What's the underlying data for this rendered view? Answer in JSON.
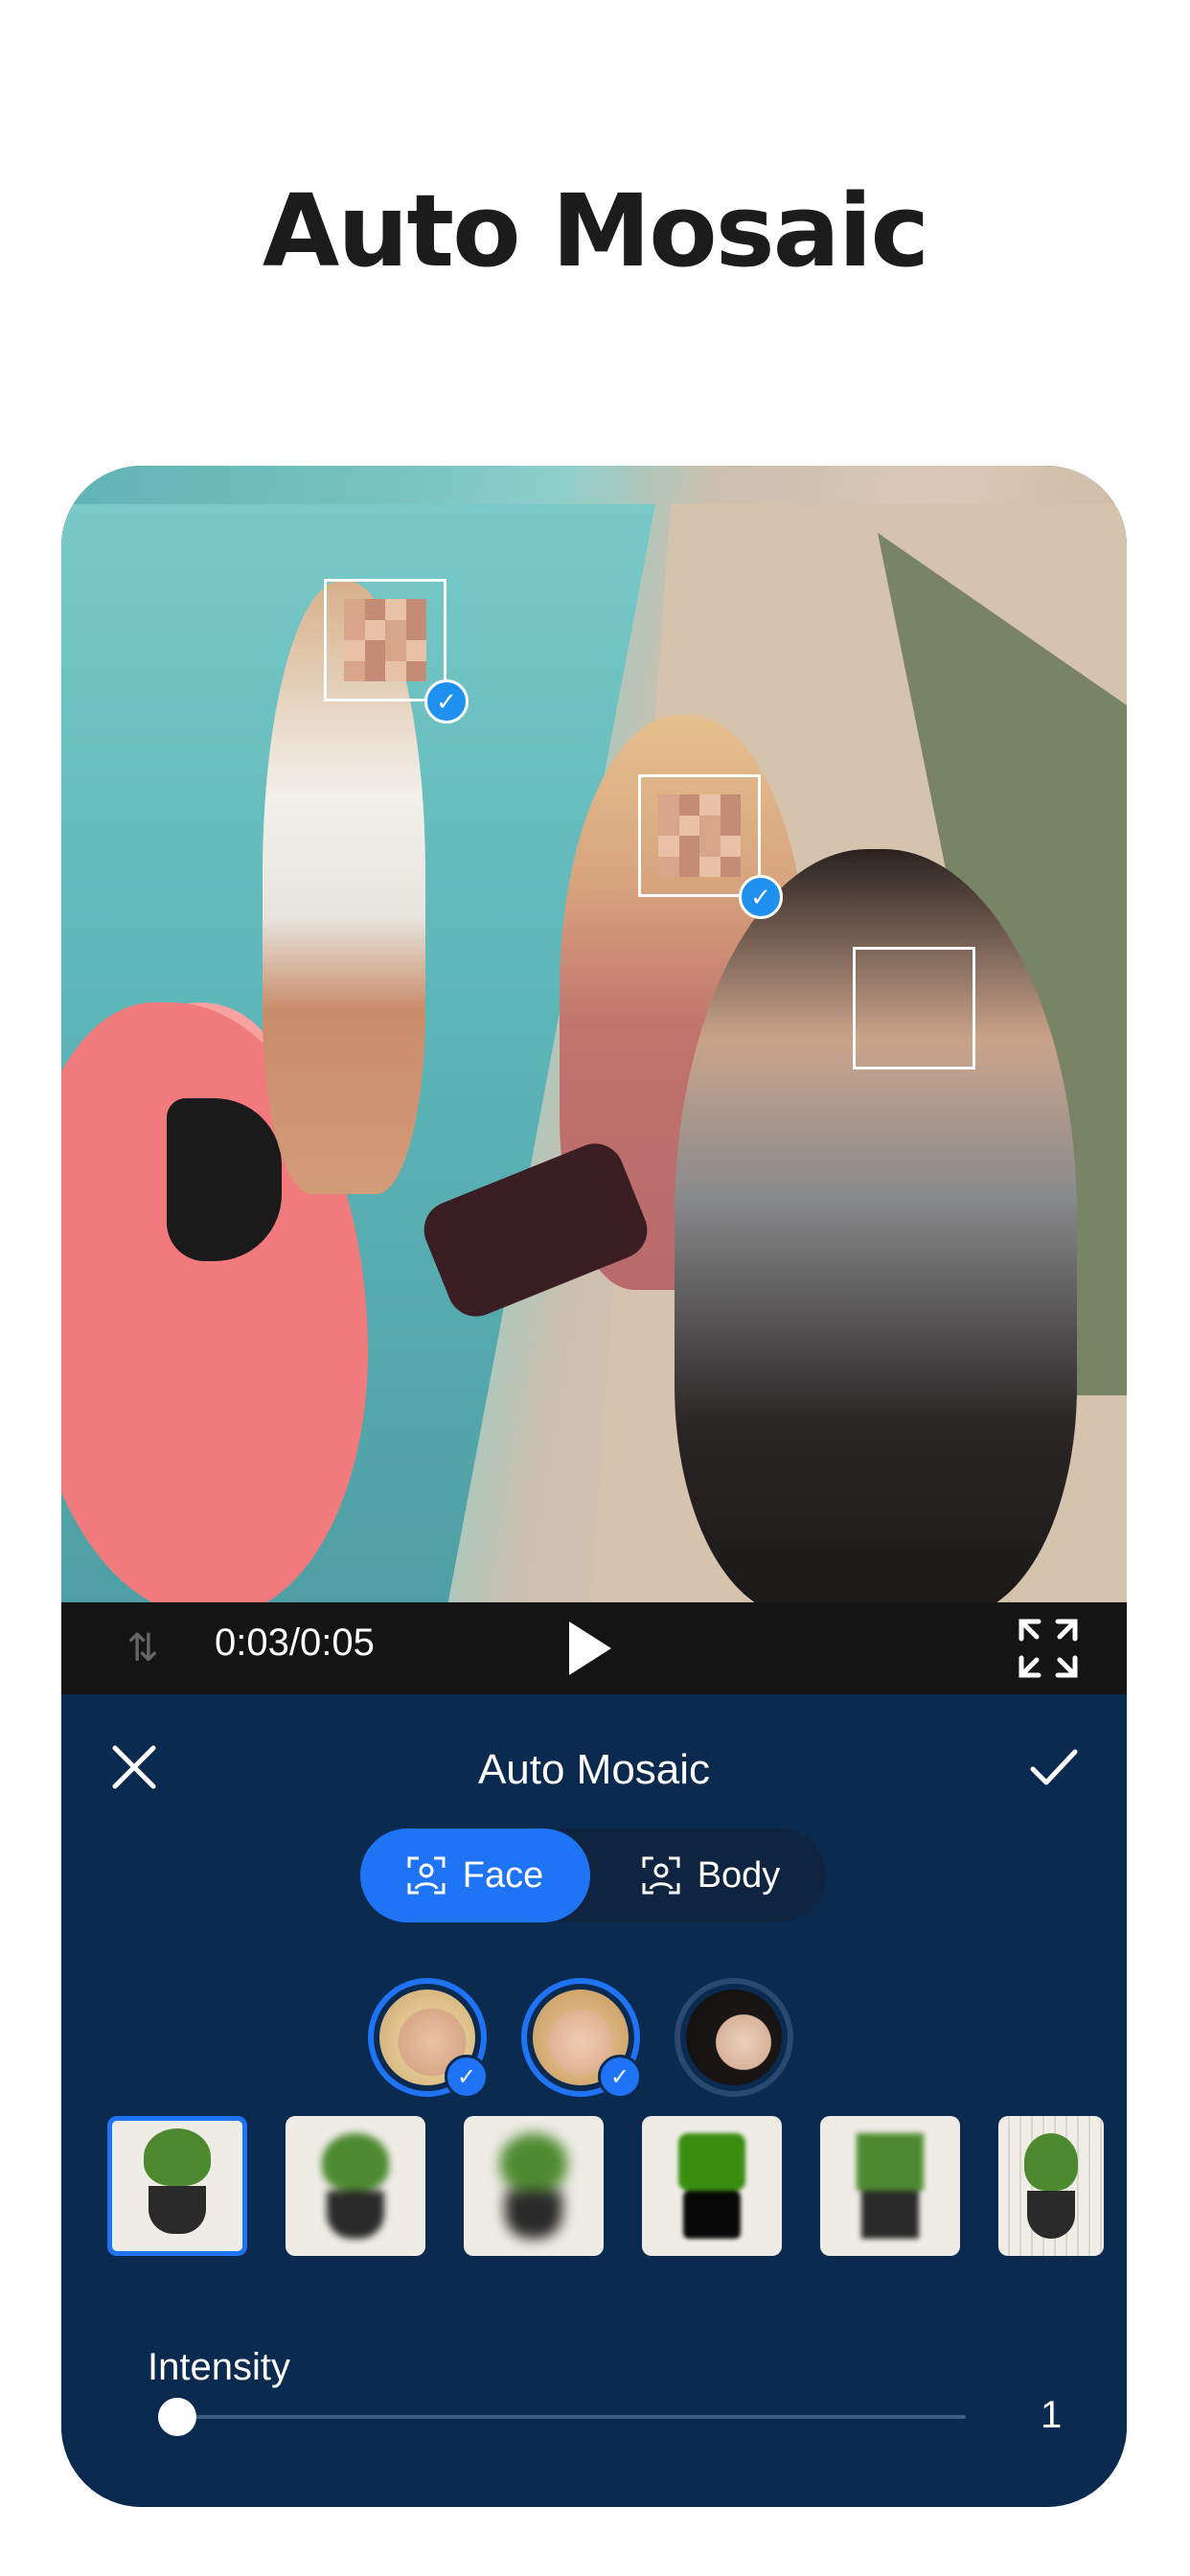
{
  "headline": "Auto Mosaic",
  "player": {
    "timecode": "0:03/0:05"
  },
  "panel": {
    "title": "Auto Mosaic",
    "segments": [
      {
        "label": "Face",
        "selected": true
      },
      {
        "label": "Body",
        "selected": false
      }
    ],
    "faces": [
      {
        "name": "face-1",
        "selected": true
      },
      {
        "name": "face-2",
        "selected": true
      },
      {
        "name": "face-3",
        "selected": false
      }
    ],
    "effects_count_visible": 6,
    "selected_effect_index": 0,
    "intensity": {
      "label": "Intensity",
      "value": "1",
      "fraction": 0.02
    }
  },
  "colors": {
    "accent": "#1f74f5",
    "panel": "#0b2a4f",
    "player_bar": "#141414"
  }
}
